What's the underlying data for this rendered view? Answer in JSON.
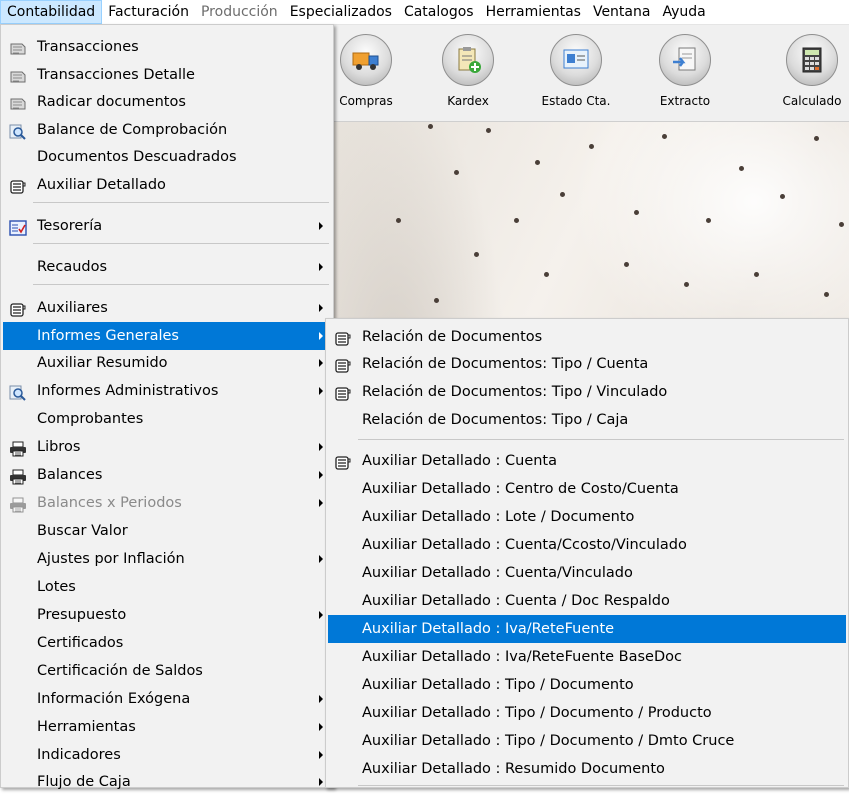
{
  "menubar": {
    "items": [
      {
        "label": "Contabilidad",
        "state": "active"
      },
      {
        "label": "Facturación",
        "state": "normal"
      },
      {
        "label": "Producción",
        "state": "disabled"
      },
      {
        "label": "Especializados",
        "state": "normal"
      },
      {
        "label": "Catalogos",
        "state": "normal"
      },
      {
        "label": "Herramientas",
        "state": "normal"
      },
      {
        "label": "Ventana",
        "state": "normal"
      },
      {
        "label": "Ayuda",
        "state": "normal"
      }
    ]
  },
  "toolbar": {
    "buttons": [
      {
        "label": "Compras",
        "icon": "truck-icon"
      },
      {
        "label": "Kardex",
        "icon": "clipboard-add-icon"
      },
      {
        "label": "Estado Cta.",
        "icon": "id-card-icon"
      },
      {
        "label": "Extracto",
        "icon": "document-arrow-icon"
      },
      {
        "label": "Calculado",
        "icon": "calculator-icon"
      }
    ]
  },
  "contabilidad_menu": {
    "items": [
      {
        "label": "Transacciones",
        "icon": "transactions-icon"
      },
      {
        "label": "Transacciones Detalle",
        "icon": "transactions-icon"
      },
      {
        "label": "Radicar documentos",
        "icon": "transactions-icon"
      },
      {
        "label": "Balance de Comprobación",
        "icon": "magnifier-icon"
      },
      {
        "label": "Documentos Descuadrados"
      },
      {
        "label": "Auxiliar Detallado",
        "icon": "report-icon"
      },
      {
        "label": "Tesorería",
        "icon": "treasury-icon",
        "submenu": true
      },
      {
        "label": "Recaudos",
        "submenu": true
      },
      {
        "label": "Auxiliares",
        "icon": "report-icon",
        "submenu": true
      },
      {
        "label": "Informes Generales",
        "submenu": true,
        "highlighted": true
      },
      {
        "label": "Auxiliar Resumido",
        "submenu": true
      },
      {
        "label": "Informes Administrativos",
        "icon": "magnifier-icon",
        "submenu": true
      },
      {
        "label": "Comprobantes"
      },
      {
        "label": "Libros",
        "icon": "printer-icon",
        "submenu": true
      },
      {
        "label": "Balances",
        "icon": "printer-icon",
        "submenu": true
      },
      {
        "label": "Balances x Periodos",
        "icon": "printer-icon",
        "submenu": true,
        "disabled": true
      },
      {
        "label": "Buscar Valor"
      },
      {
        "label": "Ajustes por Inflación",
        "submenu": true
      },
      {
        "label": "Lotes"
      },
      {
        "label": "Presupuesto",
        "submenu": true
      },
      {
        "label": "Certificados"
      },
      {
        "label": "Certificación de Saldos"
      },
      {
        "label": "Información Exógena",
        "submenu": true
      },
      {
        "label": "Herramientas",
        "submenu": true
      },
      {
        "label": "Indicadores",
        "submenu": true
      },
      {
        "label": "Flujo de Caja",
        "submenu": true
      }
    ]
  },
  "informes_generales_menu": {
    "items": [
      {
        "label": "Relación de Documentos",
        "icon": "report-icon"
      },
      {
        "label": "Relación de Documentos: Tipo / Cuenta",
        "icon": "report-icon"
      },
      {
        "label": "Relación de Documentos: Tipo / Vinculado",
        "icon": "report-icon"
      },
      {
        "label": "Relación de Documentos: Tipo / Caja"
      },
      {
        "label": "Auxiliar Detallado : Cuenta",
        "icon": "report-icon"
      },
      {
        "label": "Auxiliar Detallado : Centro de Costo/Cuenta"
      },
      {
        "label": "Auxiliar Detallado : Lote / Documento"
      },
      {
        "label": "Auxiliar Detallado : Cuenta/Ccosto/Vinculado"
      },
      {
        "label": "Auxiliar Detallado : Cuenta/Vinculado"
      },
      {
        "label": "Auxiliar Detallado : Cuenta / Doc Respaldo"
      },
      {
        "label": "Auxiliar Detallado : Iva/ReteFuente",
        "highlighted": true
      },
      {
        "label": "Auxiliar Detallado : Iva/ReteFuente BaseDoc"
      },
      {
        "label": "Auxiliar Detallado : Tipo / Documento"
      },
      {
        "label": "Auxiliar Detallado : Tipo / Documento / Producto"
      },
      {
        "label": "Auxiliar Detallado : Tipo / Documento / Dmto Cruce"
      },
      {
        "label": "Auxiliar Detallado :  Resumido Documento"
      }
    ]
  },
  "colors": {
    "highlight": "#0078d7",
    "menu_bg": "#f2f2f2",
    "menubar_active": "#cce8ff"
  }
}
